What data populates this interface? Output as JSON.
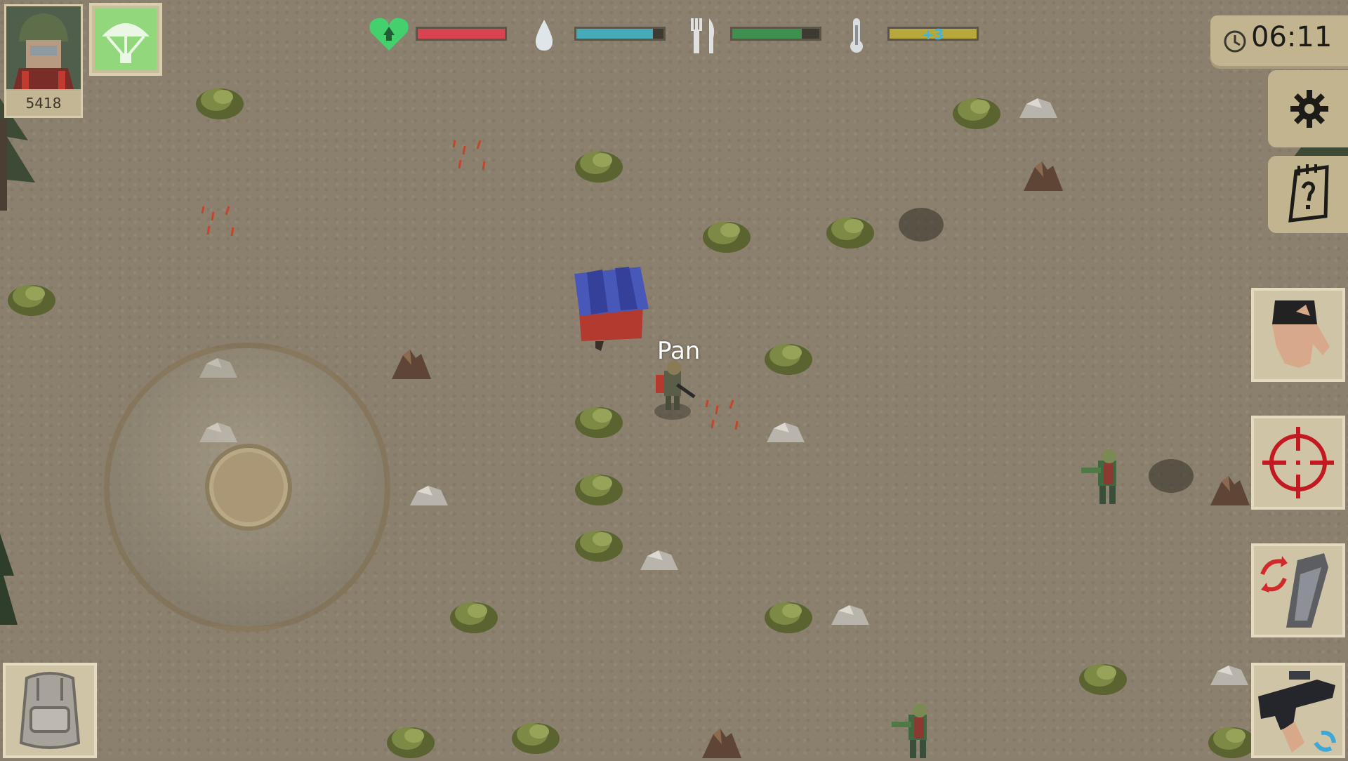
{
  "hud": {
    "score": "5418",
    "player_name": "Pan",
    "time": "06:11",
    "temperature_modifier": "+3",
    "stats": {
      "health": 1.0,
      "water": 0.88,
      "food": 0.8,
      "temperature": 1.0
    },
    "icons": {
      "health": "heart-icon",
      "water": "water-drop-icon",
      "food": "fork-knife-icon",
      "temperature": "thermometer-icon"
    },
    "colors": {
      "health": "#d8444f",
      "water": "#46aab8",
      "food": "#3f8f4f",
      "temperature": "#b6a83a",
      "heart": "#44d06c"
    }
  },
  "buttons": {
    "settings": "gear-icon",
    "quests": "notepad-question-icon",
    "grab": "hand-icon",
    "aim": "crosshair-icon",
    "reload": "reload-icon",
    "switch_weapon": "rifle-icon",
    "backpack": "backpack-icon",
    "airdrop": "parachute-icon"
  }
}
